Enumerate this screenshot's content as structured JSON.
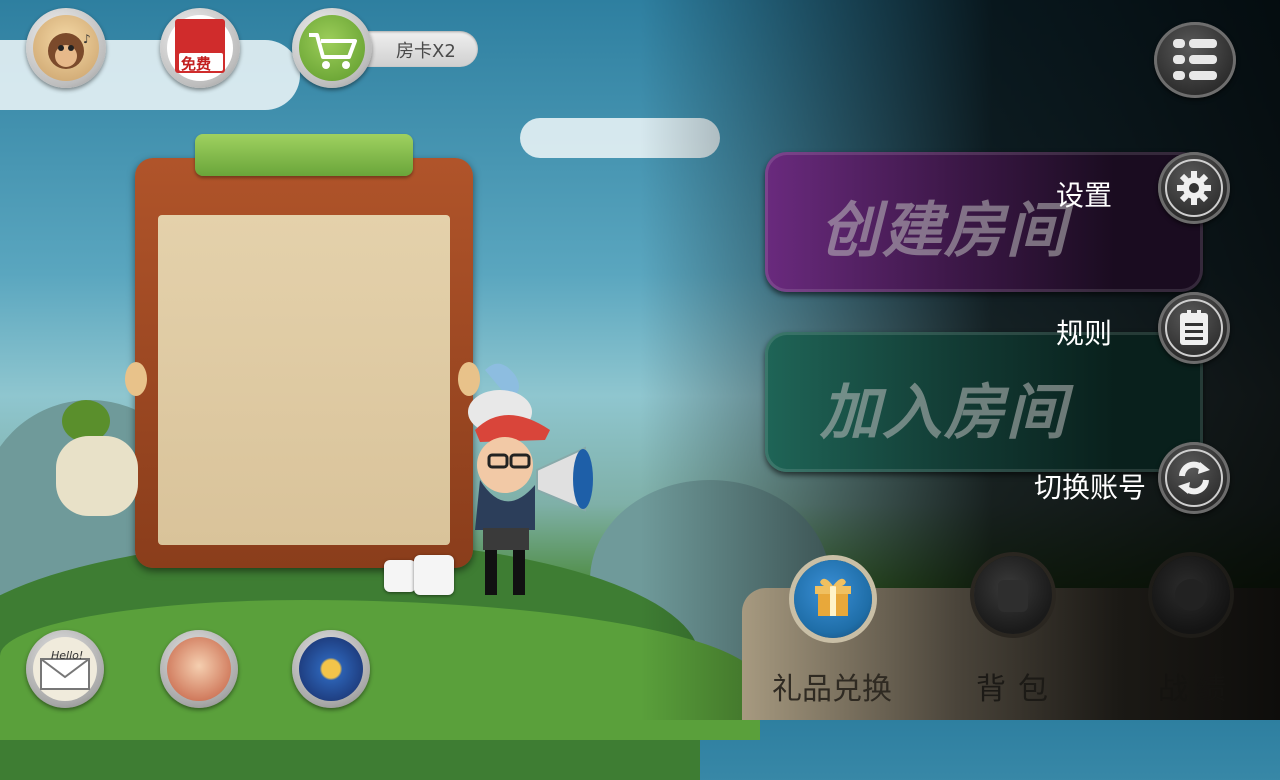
{
  "top_bar": {
    "free_badge_label": "免费",
    "room_card_label": "房卡X2"
  },
  "main": {
    "create_room_label": "创建房间",
    "join_room_label": "加入房间"
  },
  "side_menu": {
    "items": [
      {
        "label": "设置",
        "icon": "gear-icon"
      },
      {
        "label": "规则",
        "icon": "clipboard-icon"
      },
      {
        "label": "切换账号",
        "icon": "refresh-icon"
      }
    ]
  },
  "bottom_tray": {
    "tabs": [
      {
        "label": "礼品兑换",
        "icon": "gift-icon"
      },
      {
        "label": "背包",
        "icon": "backpack-icon"
      },
      {
        "label": "战绩",
        "icon": "record-icon"
      }
    ]
  },
  "bottom_left": {
    "mail_label": "Hello!"
  },
  "colors": {
    "create_button": "#6a2a7e",
    "join_button": "#1f6557",
    "menu_text": "#ffffff",
    "cart_green": "#7ab545",
    "gift_blue": "#1f6ea8"
  }
}
